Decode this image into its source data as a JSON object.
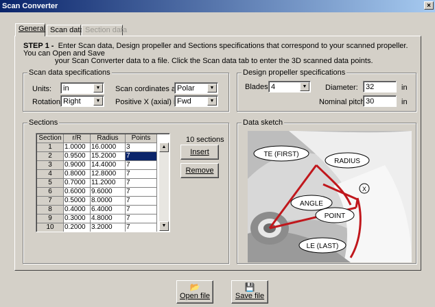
{
  "window": {
    "title": "Scan Converter",
    "close_glyph": "×"
  },
  "tabs": [
    {
      "label": "General",
      "state": "active"
    },
    {
      "label": "Scan data",
      "state": "normal"
    },
    {
      "label": "Section data",
      "state": "disabled"
    }
  ],
  "step": {
    "heading": "STEP 1 -",
    "text1": "Enter Scan data, Design propeller and Sections specifications that correspond to your scanned propeller. You can Open and Save",
    "text2": "your Scan Converter data to a file. Click the Scan data tab to enter the 3D scanned data points."
  },
  "scan_specs": {
    "title": "Scan data specifications",
    "units_label": "Units:",
    "units_value": "in",
    "rotation_label": "Rotation:",
    "rotation_value": "Right",
    "coords_label": "Scan cordinates are:",
    "coords_value": "Polar",
    "posx_label": "Positive X (axial) is:",
    "posx_value": "Fwd"
  },
  "design_specs": {
    "title": "Design propeller specifications",
    "blades_label": "Blades:",
    "blades_value": "4",
    "diameter_label": "Diameter:",
    "diameter_value": "32",
    "diameter_unit": "in",
    "pitch_label": "Nominal pitch:",
    "pitch_value": "30",
    "pitch_unit": "in"
  },
  "sections": {
    "title": "Sections",
    "count_text": "10  sections",
    "insert_label": "Insert",
    "remove_label": "Remove",
    "columns": [
      "Section",
      "r/R",
      "Radius",
      "Points"
    ],
    "rows": [
      [
        "1",
        "1.0000",
        "16.0000",
        "3"
      ],
      [
        "2",
        "0.9500",
        "15.2000",
        "7"
      ],
      [
        "3",
        "0.9000",
        "14.4000",
        "7"
      ],
      [
        "4",
        "0.8000",
        "12.8000",
        "7"
      ],
      [
        "5",
        "0.7000",
        "11.2000",
        "7"
      ],
      [
        "6",
        "0.6000",
        "9.6000",
        "7"
      ],
      [
        "7",
        "0.5000",
        "8.0000",
        "7"
      ],
      [
        "8",
        "0.4000",
        "6.4000",
        "7"
      ],
      [
        "9",
        "0.3000",
        "4.8000",
        "7"
      ],
      [
        "10",
        "0.2000",
        "3.2000",
        "7"
      ]
    ],
    "selected_row": 2
  },
  "sketch": {
    "title": "Data sketch",
    "callouts": {
      "te": "TE (FIRST)",
      "radius": "RADIUS",
      "angle": "ANGLE",
      "point": "POINT",
      "le": "LE (LAST)",
      "x_mark": "X"
    }
  },
  "footer": {
    "open_label": "Open file",
    "save_label": "Save file"
  }
}
